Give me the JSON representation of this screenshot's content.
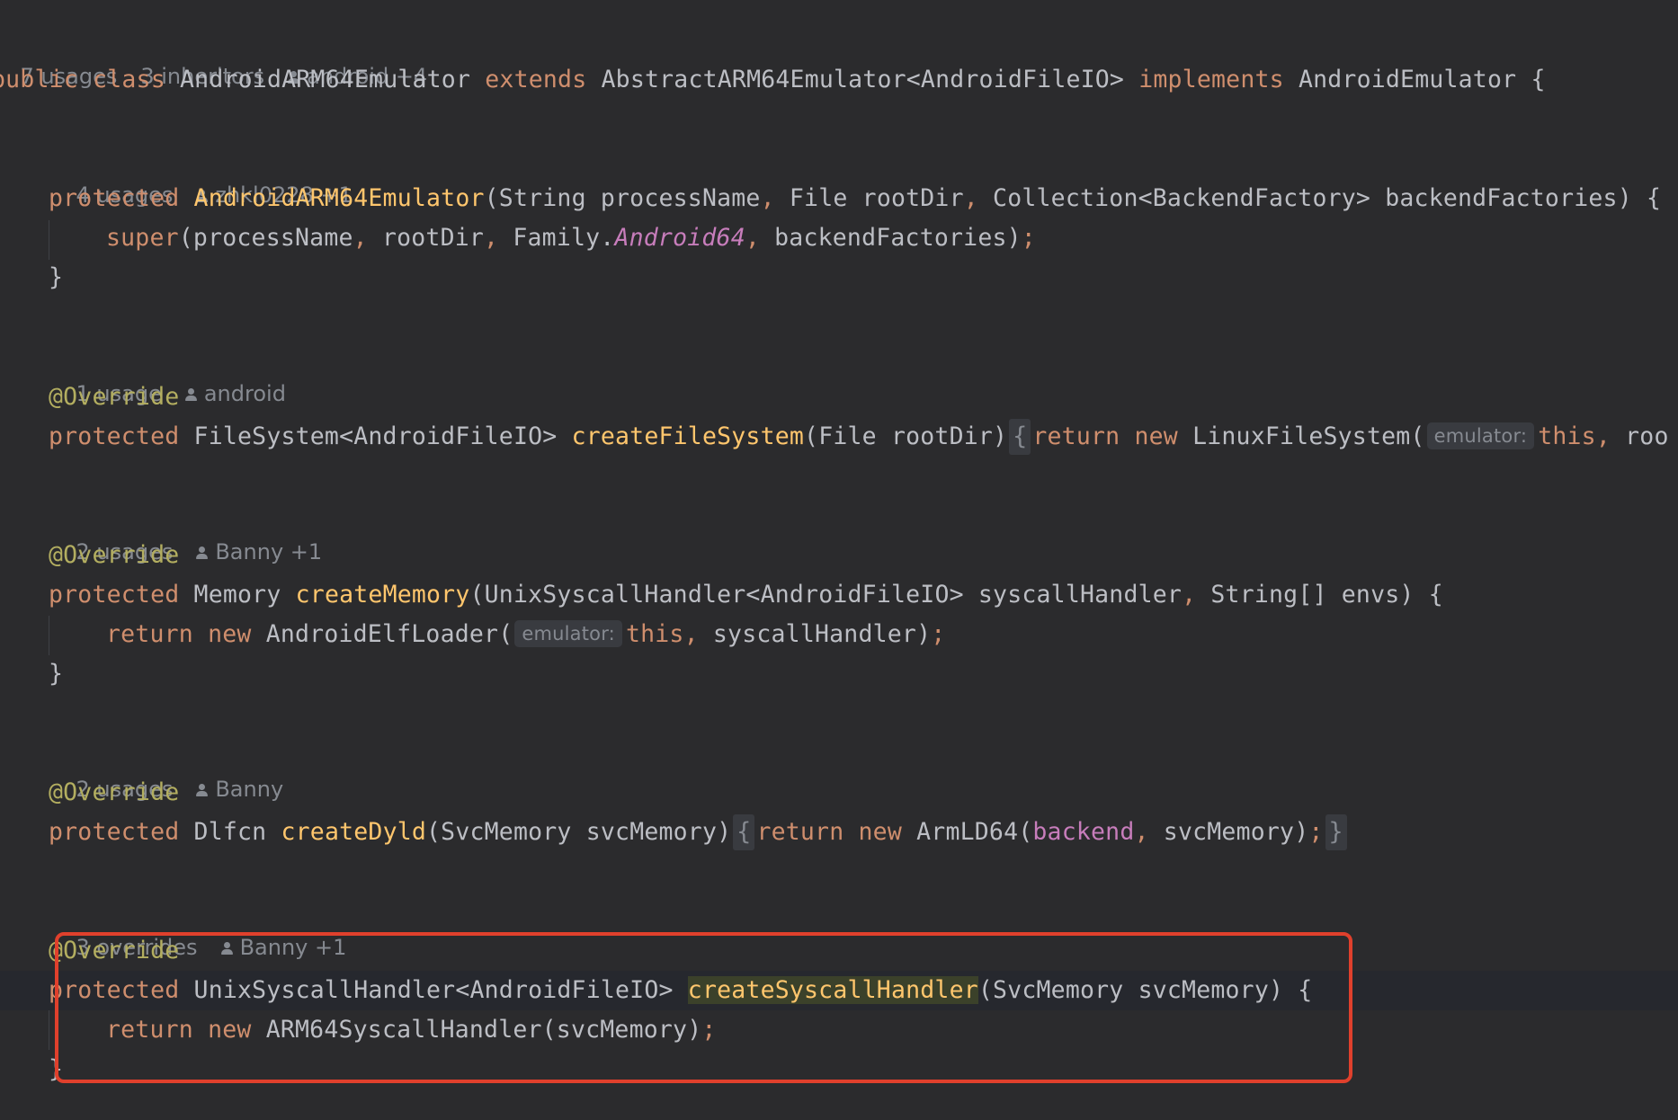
{
  "colors": {
    "background": "#2b2b2d",
    "keyword": "#cf8e6d",
    "method_declaration": "#ffc66d",
    "annotation": "#b3ae60",
    "field": "#c77dbb",
    "text": "#bcbec4",
    "inlay_meta": "#868a91",
    "highlight_box": "#e0402c"
  },
  "class_meta": {
    "usages": "7 usages",
    "inheritors": "3 inheritors",
    "authors": "android +4"
  },
  "class_decl": {
    "public": "public",
    "class_kw": "class",
    "name": "AndroidARM64Emulator",
    "extends_kw": "extends",
    "super_type": "AbstractARM64Emulator<AndroidFileIO>",
    "implements_kw": "implements",
    "interface": "AndroidEmulator",
    "open_brace": "{"
  },
  "constructor": {
    "meta_usages": "4 usages",
    "meta_authors": "zhkl0228 +1",
    "modifier": "protected",
    "name": "AndroidARM64Emulator",
    "p1": "(String processName",
    "p2": " File rootDir",
    "p3": " Collection<BackendFactory> backendFactories) {",
    "super_kw": "super",
    "super_args_1": "(processName",
    "super_args_2": " rootDir",
    "super_args_3": " Family.",
    "super_family": "Android64",
    "super_args_4": " backendFactories)",
    "semi": ";",
    "close": "}"
  },
  "create_fs": {
    "meta_usages": "1 usage",
    "meta_authors": "android",
    "annotation": "@Override",
    "modifier": "protected",
    "return_type": "FileSystem<AndroidFileIO>",
    "name": "createFileSystem",
    "params": "(File rootDir)",
    "fold_open": "{",
    "return_kw": "return",
    "new_kw": "new",
    "ctor": "LinuxFileSystem(",
    "hint": "emulator:",
    "this_kw": "this",
    "rest": " roo"
  },
  "create_memory": {
    "meta_usages": "2 usages",
    "meta_authors": "Banny +1",
    "annotation": "@Override",
    "modifier": "protected",
    "return_type": "Memory",
    "name": "createMemory",
    "params_1": "(UnixSyscallHandler<AndroidFileIO> syscallHandler",
    "params_2": " String[] envs) {",
    "return_kw": "return",
    "new_kw": "new",
    "ctor": "AndroidElfLoader(",
    "hint": "emulator:",
    "this_kw": "this",
    "args": " syscallHandler)",
    "semi": ";",
    "close": "}"
  },
  "create_dyld": {
    "meta_usages": "2 usages",
    "meta_authors": "Banny",
    "annotation": "@Override",
    "modifier": "protected",
    "return_type": "Dlfcn",
    "name": "createDyld",
    "params": "(SvcMemory svcMemory)",
    "fold_open": "{",
    "return_kw": "return",
    "new_kw": "new",
    "ctor": "ArmLD64(",
    "backend": "backend",
    "args": " svcMemory)",
    "semi": ";",
    "fold_close": "}"
  },
  "create_syscall": {
    "meta_overrides": "3 overrides",
    "meta_authors": "Banny +1",
    "annotation": "@Override",
    "modifier": "protected",
    "return_type": "UnixSyscallHandler<AndroidFileIO>",
    "name": "createSyscallHandler",
    "params": "(SvcMemory svcMemory) {",
    "return_kw": "return",
    "new_kw": "new",
    "ctor": "ARM64SyscallHandler(svcMemory)",
    "semi": ";",
    "close": "}"
  },
  "punct": {
    "comma": ","
  }
}
